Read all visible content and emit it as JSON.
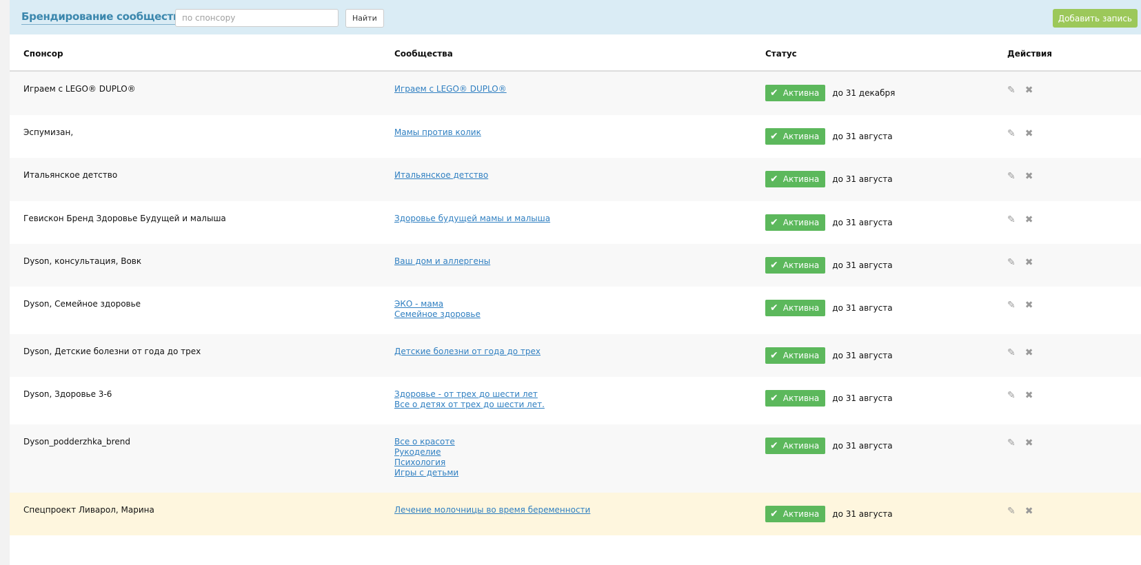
{
  "header": {
    "title": "Брендирование сообществ",
    "search_placeholder": "по спонсору",
    "search_value": "",
    "find_label": "Найти",
    "add_label": "Добавить запись"
  },
  "columns": {
    "sponsor": "Спонсор",
    "communities": "Сообщества",
    "status": "Статус",
    "actions": "Действия"
  },
  "rows": [
    {
      "sponsor": "Играем с LEGO® DUPLO®",
      "communities": [
        "Играем с LEGO® DUPLO®"
      ],
      "status": "Активна",
      "until": "до 31 декабря"
    },
    {
      "sponsor": "Эспумизан,",
      "communities": [
        "Мамы против колик"
      ],
      "status": "Активна",
      "until": "до 31 августа"
    },
    {
      "sponsor": "Итальянское детство",
      "communities": [
        "Итальянское детство"
      ],
      "status": "Активна",
      "until": "до 31 августа"
    },
    {
      "sponsor": "Гевискон Бренд Здоровье Будущей и малыша",
      "communities": [
        "Здоровье будущей мамы и малыша"
      ],
      "status": "Активна",
      "until": "до 31 августа"
    },
    {
      "sponsor": "Dyson, консультация, Вовк",
      "communities": [
        "Ваш дом и аллергены"
      ],
      "status": "Активна",
      "until": "до 31 августа"
    },
    {
      "sponsor": "Dyson, Семейное здоровье",
      "communities": [
        "ЭКО - мама",
        "Семейное здоровье"
      ],
      "status": "Активна",
      "until": "до 31 августа"
    },
    {
      "sponsor": "Dyson, Детские болезни от года до трех",
      "communities": [
        "Детские болезни от года до трех"
      ],
      "status": "Активна",
      "until": "до 31 августа"
    },
    {
      "sponsor": "Dyson, Здоровье 3-6",
      "communities": [
        "Здоровье - от трех до шести лет",
        "Все о детях от трех до шести лет."
      ],
      "status": "Активна",
      "until": "до 31 августа"
    },
    {
      "sponsor": "Dyson_podderzhka_brend",
      "communities": [
        "Все о красоте",
        "Рукоделие",
        "Психология",
        "Игры с детьми"
      ],
      "status": "Активна",
      "until": "до 31 августа"
    },
    {
      "sponsor": "Спецпроект Ливарол, Марина",
      "communities": [
        "Лечение молочницы во время беременности"
      ],
      "status": "Активна",
      "until": "до 31 августа"
    }
  ],
  "colors": {
    "accent": "#3b87ad",
    "active": "#5cb85c",
    "add": "#9cc85a",
    "highlight": "#fef6de"
  }
}
